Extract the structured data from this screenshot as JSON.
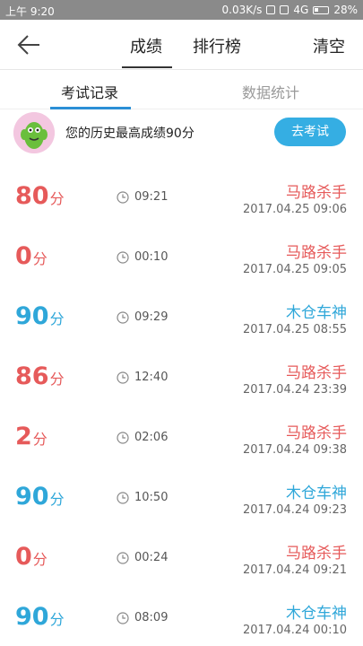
{
  "status": {
    "time": "上午 9:20",
    "speed": "0.03K/s",
    "network": "4G",
    "battery": "28%"
  },
  "header": {
    "tabs": [
      "成绩",
      "排行榜"
    ],
    "clear_label": "清空"
  },
  "subtabs": [
    "考试记录",
    "数据统计"
  ],
  "summary": {
    "text": "您的历史最高成绩90分",
    "button_label": "去考试"
  },
  "records": [
    {
      "score": "80",
      "unit": "分",
      "duration": "09:21",
      "title": "马路杀手",
      "date": "2017.04.25  09:06",
      "color": "#e65a5a"
    },
    {
      "score": "0",
      "unit": "分",
      "duration": "00:10",
      "title": "马路杀手",
      "date": "2017.04.25  09:05",
      "color": "#e65a5a"
    },
    {
      "score": "90",
      "unit": "分",
      "duration": "09:29",
      "title": "木仓车神",
      "date": "2017.04.25  08:55",
      "color": "#2fa7d9"
    },
    {
      "score": "86",
      "unit": "分",
      "duration": "12:40",
      "title": "马路杀手",
      "date": "2017.04.24  23:39",
      "color": "#e65a5a"
    },
    {
      "score": "2",
      "unit": "分",
      "duration": "02:06",
      "title": "马路杀手",
      "date": "2017.04.24  09:38",
      "color": "#e65a5a"
    },
    {
      "score": "90",
      "unit": "分",
      "duration": "10:50",
      "title": "木仓车神",
      "date": "2017.04.24  09:23",
      "color": "#2fa7d9"
    },
    {
      "score": "0",
      "unit": "分",
      "duration": "00:24",
      "title": "马路杀手",
      "date": "2017.04.24  09:21",
      "color": "#e65a5a"
    },
    {
      "score": "90",
      "unit": "分",
      "duration": "08:09",
      "title": "木仓车神",
      "date": "2017.04.24  00:10",
      "color": "#2fa7d9"
    }
  ]
}
